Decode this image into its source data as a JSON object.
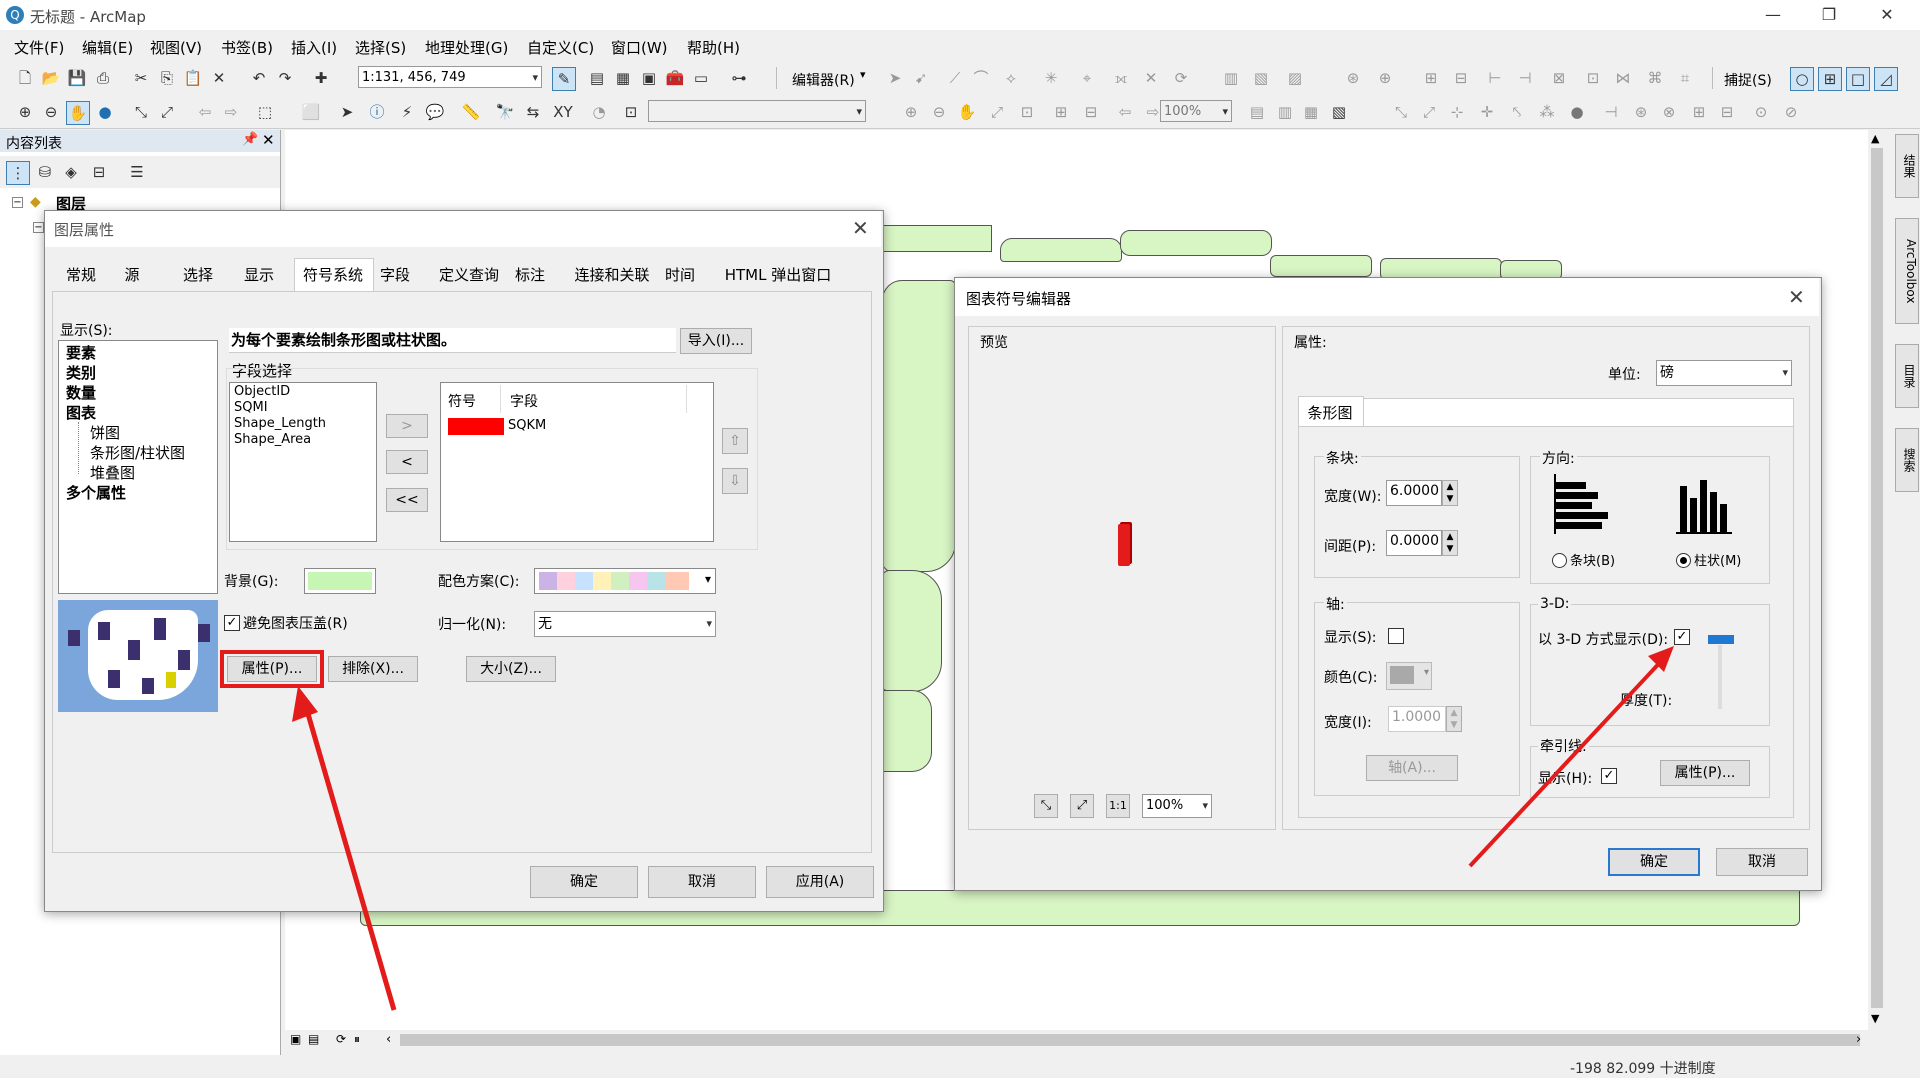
{
  "app": {
    "title": "无标题 - ArcMap"
  },
  "menu": [
    "文件(F)",
    "编辑(E)",
    "视图(V)",
    "书签(B)",
    "插入(I)",
    "选择(S)",
    "地理处理(G)",
    "自定义(C)",
    "窗口(W)",
    "帮助(H)"
  ],
  "toolbar": {
    "scale": "1:131, 456, 749",
    "editor_label": "编辑器(R)",
    "snap_label": "捕捉(S)",
    "zoom": "100%"
  },
  "toc": {
    "title": "内容列表",
    "root": "图层"
  },
  "side_tabs": [
    "结果",
    "ArcToolbox",
    "目录",
    "搜索"
  ],
  "status": {
    "coords": "-198  82.099 十进制度"
  },
  "layer_dialog": {
    "title": "图层属性",
    "tabs": [
      "常规",
      "源",
      "选择",
      "显示",
      "符号系统",
      "字段",
      "定义查询",
      "标注",
      "连接和关联",
      "时间",
      "HTML 弹出窗口"
    ],
    "show_label": "显示(S):",
    "tree": [
      "要素",
      "类别",
      "数量",
      "图表",
      "饼图",
      "条形图/柱状图",
      "堆叠图",
      "多个属性"
    ],
    "heading": "为每个要素绘制条形图或柱状图。",
    "import": "导入(I)...",
    "field_group": "字段选择",
    "fields": [
      "ObjectID",
      "SQMI",
      "Shape_Length",
      "Shape_Area"
    ],
    "move_right": ">",
    "move_left": "<",
    "move_all_left": "<<",
    "selected_headers": [
      "符号",
      "字段"
    ],
    "selected_fields": [
      {
        "color": "#ff0000",
        "field": "SQKM"
      }
    ],
    "background_label": "背景(G):",
    "background_color": "#c7f5b4",
    "color_scheme_label": "配色方案(C):",
    "avoid_overlap": "避免图表压盖(R)",
    "normalize_label": "归一化(N):",
    "normalize_value": "无",
    "properties_btn": "属性(P)...",
    "exclude_btn": "排除(X)...",
    "size_btn": "大小(Z)...",
    "ok": "确定",
    "cancel": "取消",
    "apply": "应用(A)"
  },
  "symbol_dialog": {
    "title": "图表符号编辑器",
    "preview_label": "预览",
    "properties_label": "属性:",
    "unit_label": "单位:",
    "unit_value": "磅",
    "tab": "条形图",
    "bar_group": "条块:",
    "width_label": "宽度(W):",
    "width_value": "6.0000",
    "spacing_label": "间距(P):",
    "spacing_value": "0.0000",
    "orientation_group": "方向:",
    "bar_option": "条块(B)",
    "column_option": "柱状(M)",
    "axis_group": "轴:",
    "show_label": "显示(S):",
    "color_label": "颜色(C):",
    "axis_width_label": "宽度(I):",
    "axis_width_value": "1.0000",
    "axis_btn": "轴(A)...",
    "threed_group": "3-D:",
    "threed_label": "以 3-D 方式显示(D):",
    "thickness_label": "厚度(T):",
    "leader_group": "牵引线:",
    "leader_show_label": "显示(H):",
    "leader_props_btn": "属性(P)...",
    "zoom": "100%",
    "ok": "确定",
    "cancel": "取消"
  }
}
